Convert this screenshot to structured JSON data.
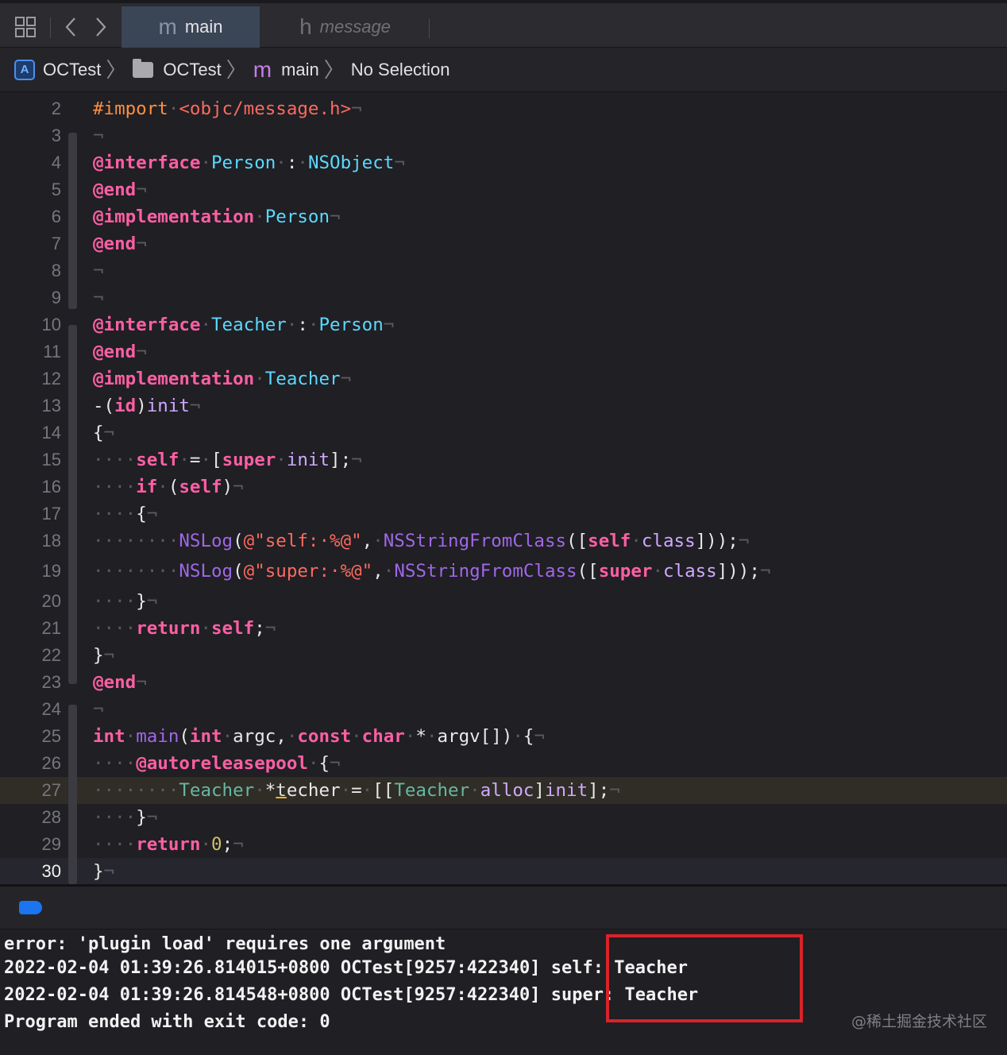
{
  "tabbar": {
    "grid_icon": "⊞",
    "back_icon": "‹",
    "forward_icon": "›",
    "tabs": [
      {
        "glyph": "m",
        "label": "main"
      },
      {
        "glyph": "h",
        "label": "message"
      }
    ]
  },
  "jumpbar": {
    "items": [
      "OCTest",
      "OCTest",
      "main",
      "No Selection"
    ],
    "separator": "〉",
    "project_icon": "A",
    "file_glyph": "m"
  },
  "code_lines": [
    {
      "n": "2",
      "tokens": [
        [
          "pp",
          "#import"
        ],
        [
          "ws",
          "·"
        ],
        [
          "str",
          "<objc/message.h>"
        ],
        [
          "ws",
          "¬"
        ]
      ]
    },
    {
      "n": "3",
      "tokens": [
        [
          "ws",
          "¬"
        ]
      ]
    },
    {
      "n": "4",
      "tokens": [
        [
          "kw",
          "@interface"
        ],
        [
          "ws",
          "·"
        ],
        [
          "ty",
          "Person"
        ],
        [
          "ws",
          "·"
        ],
        [
          "pl",
          ":"
        ],
        [
          "ws",
          "·"
        ],
        [
          "ty",
          "NSObject"
        ],
        [
          "ws",
          "¬"
        ]
      ]
    },
    {
      "n": "5",
      "tokens": [
        [
          "kw",
          "@end"
        ],
        [
          "ws",
          "¬"
        ]
      ]
    },
    {
      "n": "6",
      "tokens": [
        [
          "kw",
          "@implementation"
        ],
        [
          "ws",
          "·"
        ],
        [
          "ty",
          "Person"
        ],
        [
          "ws",
          "¬"
        ]
      ]
    },
    {
      "n": "7",
      "tokens": [
        [
          "kw",
          "@end"
        ],
        [
          "ws",
          "¬"
        ]
      ]
    },
    {
      "n": "8",
      "tokens": [
        [
          "ws",
          "¬"
        ]
      ]
    },
    {
      "n": "9",
      "tokens": [
        [
          "ws",
          "¬"
        ]
      ]
    },
    {
      "n": "10",
      "tokens": [
        [
          "kw",
          "@interface"
        ],
        [
          "ws",
          "·"
        ],
        [
          "ty",
          "Teacher"
        ],
        [
          "ws",
          "·"
        ],
        [
          "pl",
          ":"
        ],
        [
          "ws",
          "·"
        ],
        [
          "ty",
          "Person"
        ],
        [
          "ws",
          "¬"
        ]
      ]
    },
    {
      "n": "11",
      "tokens": [
        [
          "kw",
          "@end"
        ],
        [
          "ws",
          "¬"
        ]
      ]
    },
    {
      "n": "12",
      "tokens": [
        [
          "kw",
          "@implementation"
        ],
        [
          "ws",
          "·"
        ],
        [
          "ty",
          "Teacher"
        ],
        [
          "ws",
          "¬"
        ]
      ]
    },
    {
      "n": "13",
      "tokens": [
        [
          "pl",
          "-("
        ],
        [
          "kw",
          "id"
        ],
        [
          "pl",
          ")"
        ],
        [
          "ty2",
          "init"
        ],
        [
          "ws",
          "¬"
        ]
      ]
    },
    {
      "n": "14",
      "tokens": [
        [
          "pl",
          "{"
        ],
        [
          "ws",
          "¬"
        ]
      ]
    },
    {
      "n": "15",
      "tokens": [
        [
          "ws",
          "····"
        ],
        [
          "kw",
          "self"
        ],
        [
          "ws",
          "·"
        ],
        [
          "pl",
          "="
        ],
        [
          "ws",
          "·"
        ],
        [
          "pl",
          "["
        ],
        [
          "kw",
          "super"
        ],
        [
          "ws",
          "·"
        ],
        [
          "ty2",
          "init"
        ],
        [
          "pl",
          "];"
        ],
        [
          "ws",
          "¬"
        ]
      ]
    },
    {
      "n": "16",
      "tokens": [
        [
          "ws",
          "····"
        ],
        [
          "kw",
          "if"
        ],
        [
          "ws",
          "·"
        ],
        [
          "pl",
          "("
        ],
        [
          "kw",
          "self"
        ],
        [
          "pl",
          ")"
        ],
        [
          "ws",
          "¬"
        ]
      ]
    },
    {
      "n": "17",
      "tokens": [
        [
          "ws",
          "····"
        ],
        [
          "pl",
          "{"
        ],
        [
          "ws",
          "¬"
        ]
      ]
    },
    {
      "n": "18",
      "tokens": [
        [
          "ws",
          "········"
        ],
        [
          "fn",
          "NSLog"
        ],
        [
          "pl",
          "("
        ],
        [
          "str",
          "@\"self:·%@\""
        ],
        [
          "pl",
          ","
        ],
        [
          "ws",
          "·"
        ],
        [
          "fn",
          "NSStringFromClass"
        ],
        [
          "pl",
          "(["
        ],
        [
          "kw",
          "self"
        ],
        [
          "ws",
          "·"
        ],
        [
          "ty2",
          "class"
        ],
        [
          "pl",
          "]));"
        ],
        [
          "ws",
          "¬"
        ]
      ]
    },
    {
      "n": "19",
      "tokens": [
        [
          "ws",
          "········"
        ],
        [
          "fn",
          "NSLog"
        ],
        [
          "pl",
          "("
        ],
        [
          "str",
          "@\"super:·%@\""
        ],
        [
          "pl",
          ","
        ],
        [
          "ws",
          "·"
        ],
        [
          "fn",
          "NSStringFromClass"
        ],
        [
          "pl",
          "(["
        ],
        [
          "kw",
          "super"
        ],
        [
          "ws",
          "·"
        ],
        [
          "ty2",
          "class"
        ],
        [
          "pl",
          "]));"
        ],
        [
          "ws",
          "¬"
        ]
      ]
    },
    {
      "n": "20",
      "tokens": [
        [
          "ws",
          "····"
        ],
        [
          "pl",
          "}"
        ],
        [
          "ws",
          "¬"
        ]
      ]
    },
    {
      "n": "21",
      "tokens": [
        [
          "ws",
          "····"
        ],
        [
          "kw",
          "return"
        ],
        [
          "ws",
          "·"
        ],
        [
          "kw",
          "self"
        ],
        [
          "pl",
          ";"
        ],
        [
          "ws",
          "¬"
        ]
      ]
    },
    {
      "n": "22",
      "tokens": [
        [
          "pl",
          "}"
        ],
        [
          "ws",
          "¬"
        ]
      ]
    },
    {
      "n": "23",
      "tokens": [
        [
          "kw",
          "@end"
        ],
        [
          "ws",
          "¬"
        ]
      ]
    },
    {
      "n": "24",
      "tokens": [
        [
          "ws",
          "¬"
        ]
      ]
    },
    {
      "n": "25",
      "tokens": [
        [
          "kw",
          "int"
        ],
        [
          "ws",
          "·"
        ],
        [
          "fn",
          "main"
        ],
        [
          "pl",
          "("
        ],
        [
          "kw",
          "int"
        ],
        [
          "ws",
          "·"
        ],
        [
          "pl",
          "argc,"
        ],
        [
          "ws",
          "·"
        ],
        [
          "kw",
          "const"
        ],
        [
          "ws",
          "·"
        ],
        [
          "kw",
          "char"
        ],
        [
          "ws",
          "·"
        ],
        [
          "pl",
          "*"
        ],
        [
          "ws",
          "·"
        ],
        [
          "pl",
          "argv[])"
        ],
        [
          "ws",
          "·"
        ],
        [
          "pl",
          "{"
        ],
        [
          "ws",
          "¬"
        ]
      ]
    },
    {
      "n": "26",
      "tokens": [
        [
          "ws",
          "····"
        ],
        [
          "kw",
          "@autoreleasepool"
        ],
        [
          "ws",
          "·"
        ],
        [
          "pl",
          "{"
        ],
        [
          "ws",
          "¬"
        ]
      ]
    },
    {
      "n": "27",
      "tokens": [
        [
          "ws",
          "········"
        ],
        [
          "fn2",
          "Teacher"
        ],
        [
          "ws",
          "·"
        ],
        [
          "pl",
          "*"
        ],
        [
          "ul",
          "t"
        ],
        [
          "pl",
          "echer"
        ],
        [
          "ws",
          "·"
        ],
        [
          "pl",
          "="
        ],
        [
          "ws",
          "·"
        ],
        [
          "pl",
          "[["
        ],
        [
          "fn2",
          "Teacher"
        ],
        [
          "ws",
          "·"
        ],
        [
          "ty2",
          "alloc"
        ],
        [
          "pl",
          "]"
        ],
        [
          "ty2",
          "init"
        ],
        [
          "pl",
          "];"
        ],
        [
          "ws",
          "¬"
        ]
      ]
    },
    {
      "n": "28",
      "tokens": [
        [
          "ws",
          "····"
        ],
        [
          "pl",
          "}"
        ],
        [
          "ws",
          "¬"
        ]
      ]
    },
    {
      "n": "29",
      "tokens": [
        [
          "ws",
          "····"
        ],
        [
          "kw",
          "return"
        ],
        [
          "ws",
          "·"
        ],
        [
          "num",
          "0"
        ],
        [
          "pl",
          ";"
        ],
        [
          "ws",
          "¬"
        ]
      ]
    },
    {
      "n": "30",
      "tokens": [
        [
          "pl",
          "}"
        ],
        [
          "ws",
          "¬"
        ]
      ]
    }
  ],
  "console": {
    "lines": [
      "error: 'plugin load' requires one argument",
      "2022-02-04 01:39:26.814015+0800 OCTest[9257:422340] self: Teacher",
      "2022-02-04 01:39:26.814548+0800 OCTest[9257:422340] super: Teacher",
      "Program ended with exit code: 0"
    ]
  },
  "watermark": "@稀土掘金技术社区",
  "colors": {
    "keyword": "#fc5fa3",
    "preprocessor": "#fd8f3f",
    "string": "#fc6a5d",
    "type": "#5dd8ff",
    "method": "#d0a8ff",
    "function": "#a167e6",
    "highlight_box": "#d8232a",
    "debug_indicator": "#1b74f0"
  }
}
